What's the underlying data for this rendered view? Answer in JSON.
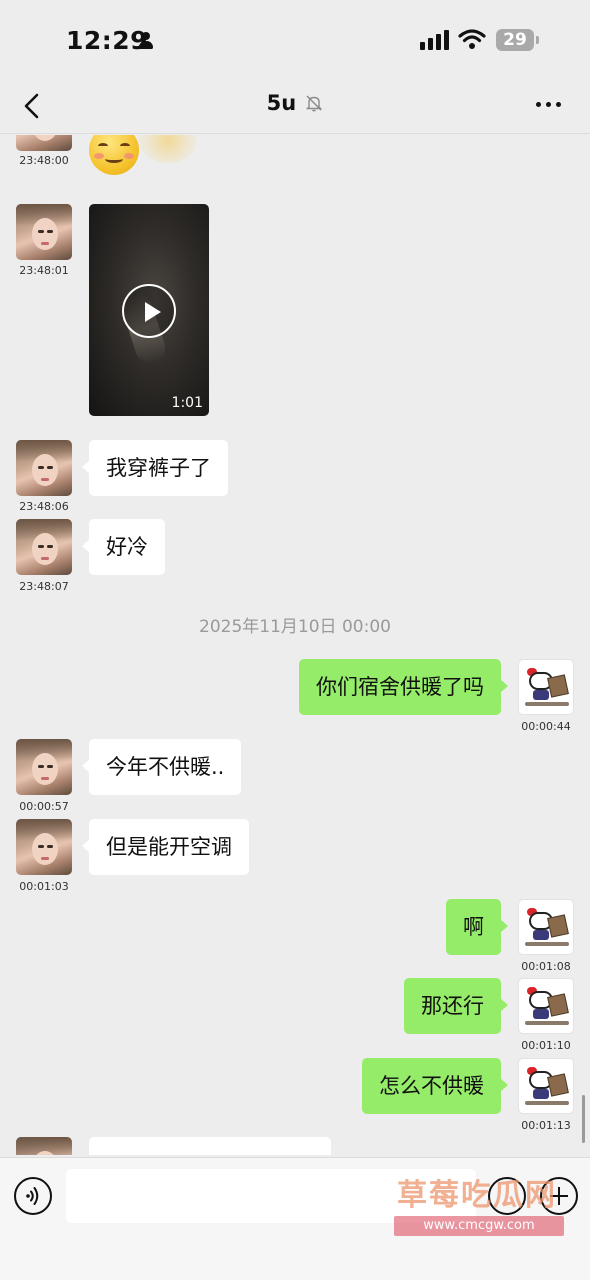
{
  "status_bar": {
    "time": "12:29",
    "battery": "29"
  },
  "header": {
    "title": "5u"
  },
  "messages": [
    {
      "side": "left",
      "type": "emoji",
      "time": "23:48:00"
    },
    {
      "side": "left",
      "type": "video",
      "time": "23:48:01",
      "duration": "1:01"
    },
    {
      "side": "left",
      "type": "text",
      "text": "我穿裤子了",
      "time": "23:48:06"
    },
    {
      "side": "left",
      "type": "text",
      "text": "好冷",
      "time": "23:48:07"
    },
    {
      "type": "date_divider",
      "text": "2025年11月10日 00:00"
    },
    {
      "side": "right",
      "type": "text",
      "text": "你们宿舍供暖了吗",
      "time": "00:00:44"
    },
    {
      "side": "left",
      "type": "text",
      "text": "今年不供暖..",
      "time": "00:00:57"
    },
    {
      "side": "left",
      "type": "text",
      "text": "但是能开空调",
      "time": "00:01:03"
    },
    {
      "side": "right",
      "type": "text",
      "text": "啊",
      "time": "00:01:08"
    },
    {
      "side": "right",
      "type": "text",
      "text": "那还行",
      "time": "00:01:10"
    },
    {
      "side": "right",
      "type": "text",
      "text": "怎么不供暖",
      "time": "00:01:13"
    }
  ],
  "input_bar": {
    "value": "",
    "placeholder": ""
  },
  "watermark": {
    "title": "草莓吃瓜网",
    "url": "www.cmcgw.com"
  },
  "icons": {
    "back": "back-chevron-icon",
    "mute": "mute-bell-icon",
    "more": "more-dots-icon",
    "voice": "voice-icon",
    "emoji": "emoji-icon",
    "plus": "plus-icon"
  },
  "colors": {
    "background": "#ededed",
    "sent_bubble": "#95ec69",
    "received_bubble": "#ffffff"
  }
}
